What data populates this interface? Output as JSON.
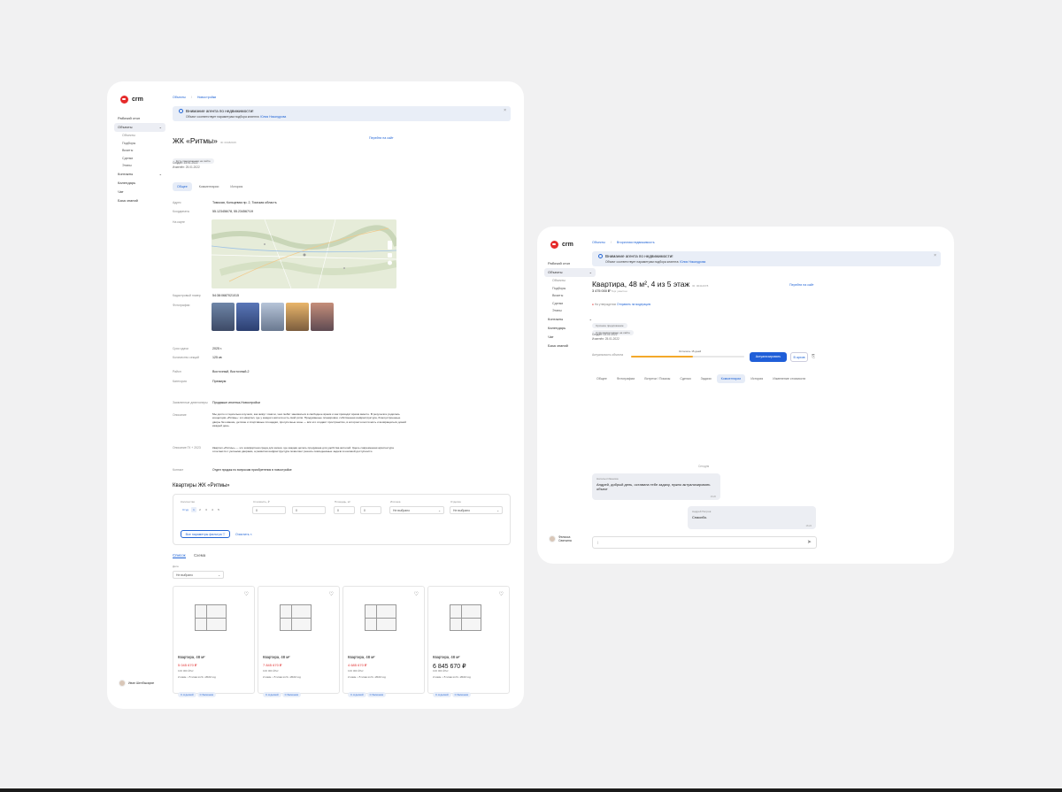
{
  "colors": {
    "accent": "#2366d6",
    "brand": "#e52a2a",
    "bg": "#f1f1f2"
  },
  "app": {
    "logo": "crm"
  },
  "nav": {
    "desk": "Рабочий стол",
    "objects": "Объекты",
    "subs": [
      "Объекты",
      "Подборы",
      "Визиты",
      "Сделки",
      "Этапы"
    ],
    "contacts": "Контакты",
    "calendar": "Календарь",
    "chat": "Чат",
    "kb": "База знаний"
  },
  "user1": {
    "name": "Иван Шелбыкарин"
  },
  "user2": {
    "name": "Феликса Святкина"
  },
  "left": {
    "breadcrumb": [
      "Объекты",
      "Новостройки"
    ],
    "alert_title": "Внимание агента по недвижимости!",
    "alert_text": "Объект соответствует параметрам подбора клиента:",
    "alert_link": "Юлия Никандрова",
    "title": "ЖК «Ритмы»",
    "title_id": "ID: 00482015",
    "share": "Перейти на сайт",
    "chip": "Есть предложения на сайте",
    "created": "Создан: 23.01.2022",
    "updated": "Изменён: 25.01.2022",
    "tabs": [
      "Общее",
      "Комментарии",
      "История"
    ],
    "address_label": "Адрес",
    "address": "Томская, Кольцевая пр. 2, Томская область",
    "coords_label": "Координаты",
    "coords": "55.123456/78, 55.234567/19",
    "map_label": "На карте",
    "cadastral_label": "Кадастровый номер",
    "cadastral": "54:38:0687021015",
    "photos_label": "Фотографии",
    "year_label": "Срок сдачи",
    "year": "2025 г.",
    "floors_label": "Количество секций",
    "floors": "125 кв",
    "district_label": "Район",
    "district": "Восточный, Восточный-2",
    "class_label": "Категория",
    "class": "Премиум",
    "developer_label": "Заявленные девелоперы",
    "developer": "Продакшн ипотека-Новостройки",
    "description_label": "Описание",
    "description": "Мы долго и тщательно изучали, как живут томичи, чем любят заниматься в свободное время и как проводят время вместе. В результате родилась концепция «Ритмы»: это квартал, где у каждого жителя есть свой ритм. Продуманные планировки, собственная инфраструктура, благоустроенные дворы без машин, детские и спортивные площадки, прогулочные зоны — всё это создаёт пространство, в котором хочется жить и возвращаться домой каждый день.",
    "docs_label": "Описание ГК + 2023",
    "docs": "Квартал «Ритмы» — это комфортная среда для жизни, где каждая деталь продумана для удобства жителей. Здесь современная архитектура сочетается с уютными дворами, а развитая инфраструктура позволяет решать повседневные задачи в шаговой доступности.",
    "contact_label": "Контакт",
    "contact": "Отдел продаж по вопросам приобретения в новостройке",
    "listing_title": "Квартиры ЖК «Ритмы»",
    "f_rooms": "Количество",
    "rooms": [
      "Студ",
      "1",
      "2",
      "3",
      "4",
      "5"
    ],
    "f_price": "Стоимость, ₽",
    "price_from": "0",
    "price_to": "0",
    "f_area": "Площадь, м²",
    "area_from": "0",
    "area_to": "0",
    "f_mortgage": "Ипотека",
    "mortgage": "Не выбрано",
    "f_finish": "Отделка",
    "finish": "Не выбрано",
    "btn_more": "Все параметры фильтра",
    "btn_reset": "Очистить",
    "view_list": "Список",
    "view_scheme": "Схема",
    "sort_label": "Дата",
    "sort": "Не выбрано",
    "cards": [
      {
        "title": "Квартира, 48 м²",
        "price": "5 045 670 ₽",
        "pm": "100 000 ₽/м²",
        "meta": "2 комн. • 5 этаж из 9 • 2022 год"
      },
      {
        "title": "Квартира, 48 м²",
        "price": "7 845 670 ₽",
        "pm": "100 000 ₽/м²",
        "meta": "2 комн. • 5 этаж из 9 • 2022 год"
      },
      {
        "title": "Квартира, 48 м²",
        "price": "4 685 670 ₽",
        "pm": "100 000 ₽/м²",
        "meta": "2 комн. • 5 этаж из 9 • 2022 год"
      },
      {
        "title": "Квартира, 48 м²",
        "price": "6 845 670 ₽",
        "pm": "100 000 ₽/м²",
        "meta": "2 комн. • 5 этаж из 9 • 2022 год"
      }
    ],
    "tag1": "С отделкой",
    "tag2": "С балконом"
  },
  "right": {
    "breadcrumb": [
      "Объекты",
      "Вторичная недвижимость"
    ],
    "alert_title": "Внимание агента по недвижимости!",
    "alert_text": "Объект соответствует параметрам подбора клиента:",
    "alert_link": "Юлия Никандрова",
    "title": "Квартира, 48 м², 4 из 5 этаж",
    "title_id": "ID: 00412678",
    "price": "3 475 000 ₽",
    "price_sub": "Торг уместен",
    "share": "Перейти на сайт",
    "status": "На утверждении",
    "status_link": "Отправить на модерацию",
    "chip1": "Срочное предложение",
    "chip2": "Отформатировано на сайте",
    "created": "Создан: 23.01.2022",
    "updated": "Изменён: 25.01.2022",
    "actuality_label": "Актуальность объекта",
    "actuality_value": "Осталось 15 дней",
    "actuality_progress": 0.55,
    "btn_actualize": "Актуализировать",
    "btn_archive": "В архив",
    "tabs": [
      "Общее",
      "Фотографии",
      "Встречи / Показы",
      "Сделки",
      "Задачи",
      "Комментарии",
      "История",
      "Изменение стоимости"
    ],
    "chat_date": "Сегодня",
    "msg1_name": "Наталья Иванова",
    "msg1_text": "Андрей, добрый день, оставила тебе задачу, нужно актуализировать объект",
    "msg1_time": "16:20",
    "msg2_name": "Андрей Петров",
    "msg2_text": "Спасибо.",
    "msg2_time": "16:24",
    "input_placeholder": "|"
  }
}
